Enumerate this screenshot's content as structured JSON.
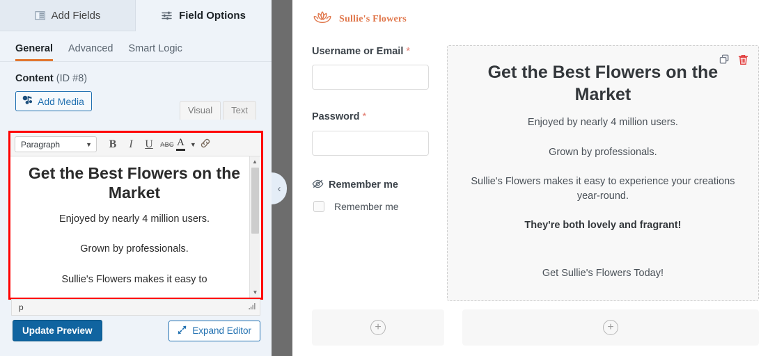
{
  "builder": {
    "tabs": [
      {
        "label": "Add Fields",
        "icon": "fields-list-icon",
        "active": false
      },
      {
        "label": "Field Options",
        "icon": "sliders-icon",
        "active": true
      }
    ],
    "subtabs": [
      {
        "label": "General",
        "active": true
      },
      {
        "label": "Advanced",
        "active": false
      },
      {
        "label": "Smart Logic",
        "active": false
      }
    ],
    "content_section": {
      "title": "Content",
      "id_text": "(ID #8)"
    },
    "add_media_label": "Add Media",
    "editor_mode_tabs": [
      {
        "label": "Visual",
        "active": true
      },
      {
        "label": "Text",
        "active": false
      }
    ],
    "toolbar": {
      "format_select": "Paragraph",
      "bold": "B",
      "italic": "I",
      "underline": "U",
      "strikethrough": "ABC",
      "text_color": "A",
      "link_icon": "link-icon",
      "caret": "▼"
    },
    "editor_content": {
      "heading": "Get the Best Flowers on the Market",
      "paragraphs": [
        "Enjoyed by nearly 4 million users.",
        "Grown by professionals.",
        "Sullie's Flowers makes it easy to"
      ]
    },
    "path_bar": {
      "value": "p",
      "grip": "resize-grip-icon"
    },
    "buttons": {
      "update_preview": "Update Preview",
      "expand_editor": "Expand Editor",
      "expand_icon": "expand-arrows-icon"
    },
    "highlight_color": "#ff0000",
    "accent_color": "#e27730",
    "primary_button_color": "#1064a0"
  },
  "divider": {
    "collapse_icon": "chevron-left-icon",
    "collapse_glyph": "‹"
  },
  "preview": {
    "brand": {
      "name": "Sullie's Flowers",
      "logo_icon": "lotus-flower-icon",
      "color": "#e0764a"
    },
    "form_fields": [
      {
        "label": "Username or Email",
        "required_marker": "*",
        "value": "",
        "type": "text"
      },
      {
        "label": "Password",
        "required_marker": "*",
        "value": "",
        "type": "password"
      }
    ],
    "hidden_field": {
      "icon": "eye-slash-icon",
      "label": "Remember me"
    },
    "checkbox": {
      "label": "Remember me",
      "checked": false
    },
    "content_card": {
      "heading": "Get the Best Flowers on the Market",
      "paragraphs": [
        "Enjoyed by nearly 4 million users.",
        "Grown by professionals.",
        "Sullie's Flowers makes it easy to experience your creations year-round."
      ],
      "bold_paragraph": "They're both lovely and fragrant!",
      "closing_paragraph": "Get Sullie's Flowers Today!",
      "actions": [
        {
          "name": "duplicate",
          "icon": "duplicate-icon",
          "color": "#6b7280"
        },
        {
          "name": "delete",
          "icon": "trash-icon",
          "color": "#e03b3b"
        }
      ]
    },
    "add_field_placeholders": [
      {
        "icon": "plus-circle-icon",
        "glyph": "+"
      },
      {
        "icon": "plus-circle-icon",
        "glyph": "+"
      }
    ]
  }
}
